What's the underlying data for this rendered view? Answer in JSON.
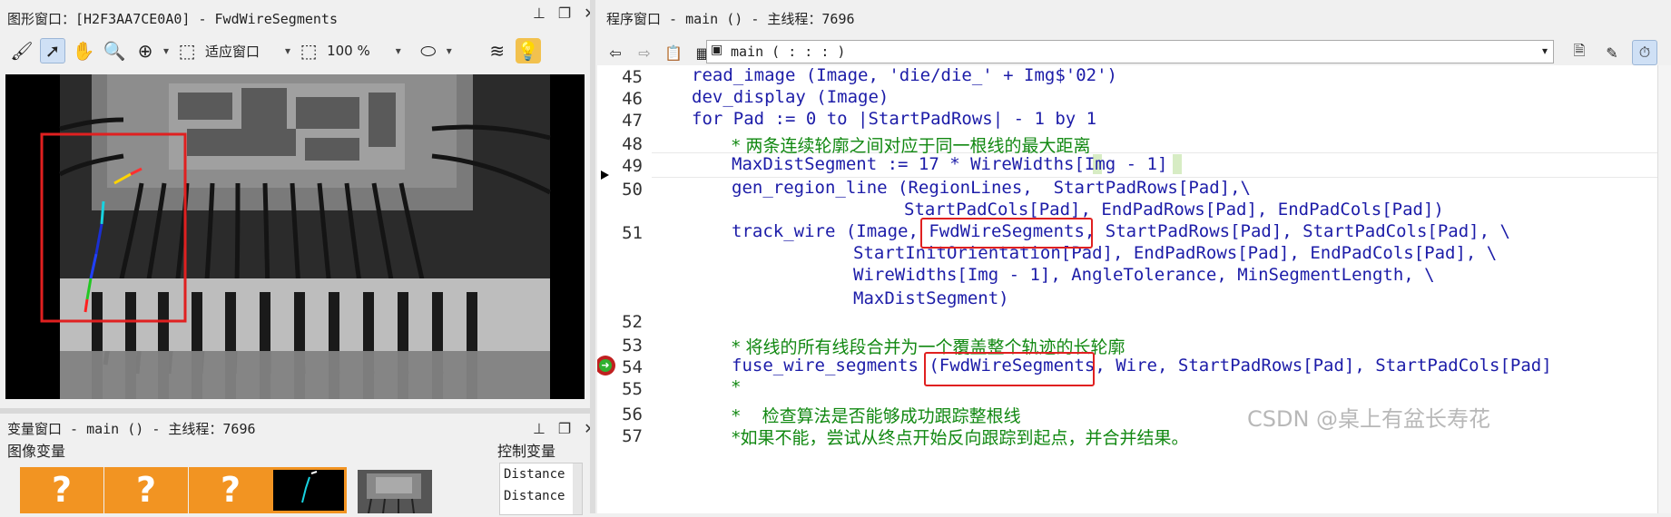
{
  "graphics_window": {
    "title": "图形窗口：[H2F3AA7CE0A0] - FwdWireSegments",
    "toolbar": {
      "fit_label": "适应窗口",
      "zoom_label": "100 %"
    }
  },
  "variable_window": {
    "title": "变量窗口 - main () - 主线程：7696",
    "image_vars_label": "图像变量",
    "control_vars_label": "控制变量",
    "thumbs": [
      "?",
      "?",
      "?"
    ],
    "control_items": [
      "Distance",
      "Distance"
    ]
  },
  "program_window": {
    "title": "程序窗口 - main () - 主线程：7696",
    "procedure_selector": "main ( : : : )",
    "lines": [
      {
        "num": "45",
        "text": "read_image (Image, 'die/die_' + Img$'02')"
      },
      {
        "num": "46",
        "text": "dev_display (Image)"
      },
      {
        "num": "47",
        "text": "for Pad := 0 to |StartPadRows| - 1 by 1"
      },
      {
        "num": "48",
        "text": "* 两条连续轮廓之间对应于同一根线的最大距离"
      },
      {
        "num": "49",
        "text": "MaxDistSegment := 17 * WireWidths[Img - 1]"
      },
      {
        "num": "50",
        "text": "gen_region_line (RegionLines,  StartPadRows[Pad],\\"
      },
      {
        "num": "",
        "text": "StartPadCols[Pad], EndPadRows[Pad], EndPadCols[Pad])"
      },
      {
        "num": "51",
        "text": "track_wire (Image, FwdWireSegments, StartPadRows[Pad], StartPadCols[Pad], \\"
      },
      {
        "num": "",
        "text": "StartInitOrientation[Pad], EndPadRows[Pad], EndPadCols[Pad], \\"
      },
      {
        "num": "",
        "text": "WireWidths[Img - 1], AngleTolerance, MinSegmentLength, \\"
      },
      {
        "num": "",
        "text": "MaxDistSegment)"
      },
      {
        "num": "52",
        "text": ""
      },
      {
        "num": "53",
        "text": "* 将线的所有线段合并为一个覆盖整个轨迹的长轮廓"
      },
      {
        "num": "54",
        "text": "fuse_wire_segments (FwdWireSegments, Wire, StartPadRows[Pad], StartPadCols[Pad]"
      },
      {
        "num": "55",
        "text": "*"
      },
      {
        "num": "56",
        "text": "*    检查算法是否能够成功跟踪整根线"
      },
      {
        "num": "57",
        "text": "*如果不能，尝试从终点开始反向跟踪到起点，并合并结果。"
      }
    ]
  },
  "watermark": "CSDN @桌上有盆长寿花",
  "colors": {
    "highlight": "#e02020",
    "code": "#1c1ca8",
    "comment": "#118811"
  }
}
